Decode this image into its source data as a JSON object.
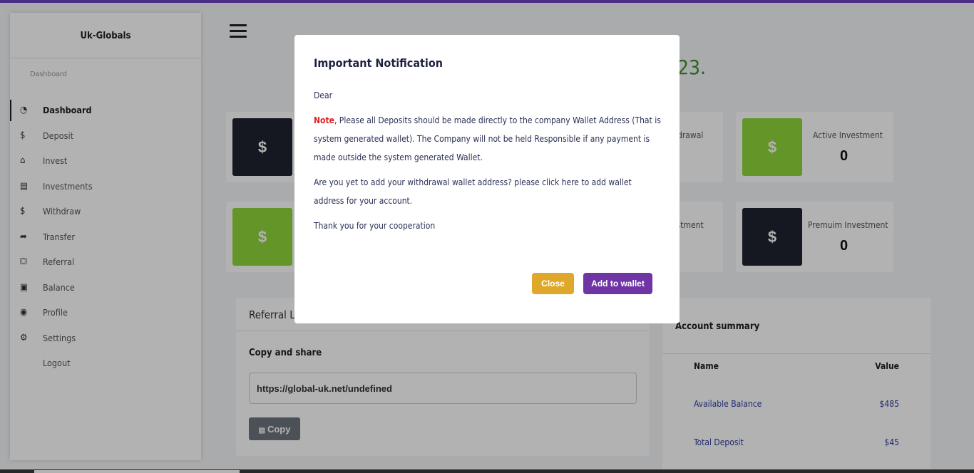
{
  "sidebar": {
    "brand": "Uk-Globals",
    "section_label": "Dashboard",
    "items": [
      {
        "label": "Dashboard",
        "icon": "gauge-icon",
        "glyph": "◔"
      },
      {
        "label": "Deposit",
        "icon": "dollar-icon",
        "glyph": "$"
      },
      {
        "label": "Invest",
        "icon": "bank-icon",
        "glyph": "⌂"
      },
      {
        "label": "Investments",
        "icon": "document-icon",
        "glyph": "▤"
      },
      {
        "label": "Withdraw",
        "icon": "dollar-icon",
        "glyph": "$"
      },
      {
        "label": "Transfer",
        "icon": "share-icon",
        "glyph": "➦"
      },
      {
        "label": "Referral",
        "icon": "referral-icon",
        "glyph": "⛋"
      },
      {
        "label": "Balance",
        "icon": "wallet-icon",
        "glyph": "▣"
      },
      {
        "label": "Profile",
        "icon": "user-circle-icon",
        "glyph": "◉"
      },
      {
        "label": "Settings",
        "icon": "gear-icon",
        "glyph": "⚙"
      },
      {
        "label": "Logout",
        "icon": "",
        "glyph": ""
      }
    ]
  },
  "main": {
    "greeting_fragment": "23.",
    "stats": [
      {
        "label": "",
        "value": "",
        "icon": "dollar-icon",
        "glyph": "$",
        "theme": "dark"
      },
      {
        "label": "drawal",
        "value": "",
        "icon": "",
        "glyph": "",
        "theme": ""
      },
      {
        "label": "Active Investment",
        "value": "0",
        "icon": "dollar-icon",
        "glyph": "$",
        "theme": "green"
      },
      {
        "label": "",
        "value": "",
        "icon": "dollar-icon",
        "glyph": "$",
        "theme": "green"
      },
      {
        "label": "estment",
        "value": "",
        "icon": "",
        "glyph": "",
        "theme": ""
      },
      {
        "label": "Premuim Investment",
        "value": "0",
        "icon": "dollar-icon",
        "glyph": "$",
        "theme": "dark"
      }
    ],
    "referral": {
      "header": "Referral Li",
      "subtitle": "Copy and share",
      "link": "https://global-uk.net/undefined",
      "copy_label": "Copy"
    },
    "account_summary": {
      "title": "Account summary",
      "columns": [
        "Name",
        "Value"
      ],
      "rows": [
        {
          "name": "Available Balance",
          "value": "$485"
        },
        {
          "name": "Total Deposit",
          "value": "$45"
        }
      ]
    }
  },
  "modal": {
    "title": "Important Notification",
    "greeting": "Dear",
    "note_label": "Note",
    "note_text": ", Please all Deposits should be made directly to the company Wallet Address (That is system generated wallet). The Company will not be held Responsible if any payment is made outside the system generated Wallet.",
    "wallet_prompt": "Are you yet to add your withdrawal wallet address? please click here to add wallet address for your account.",
    "thanks": "Thank you for your cooperation",
    "close_label": "Close",
    "add_wallet_label": "Add to wallet"
  },
  "colors": {
    "accent": "#6f42c1",
    "close_button": "#e0a82a",
    "add_wallet_button": "#6f35a5",
    "stat_green": "#8fd63c",
    "stat_dark": "#1f2230",
    "note_red": "#e02020"
  }
}
